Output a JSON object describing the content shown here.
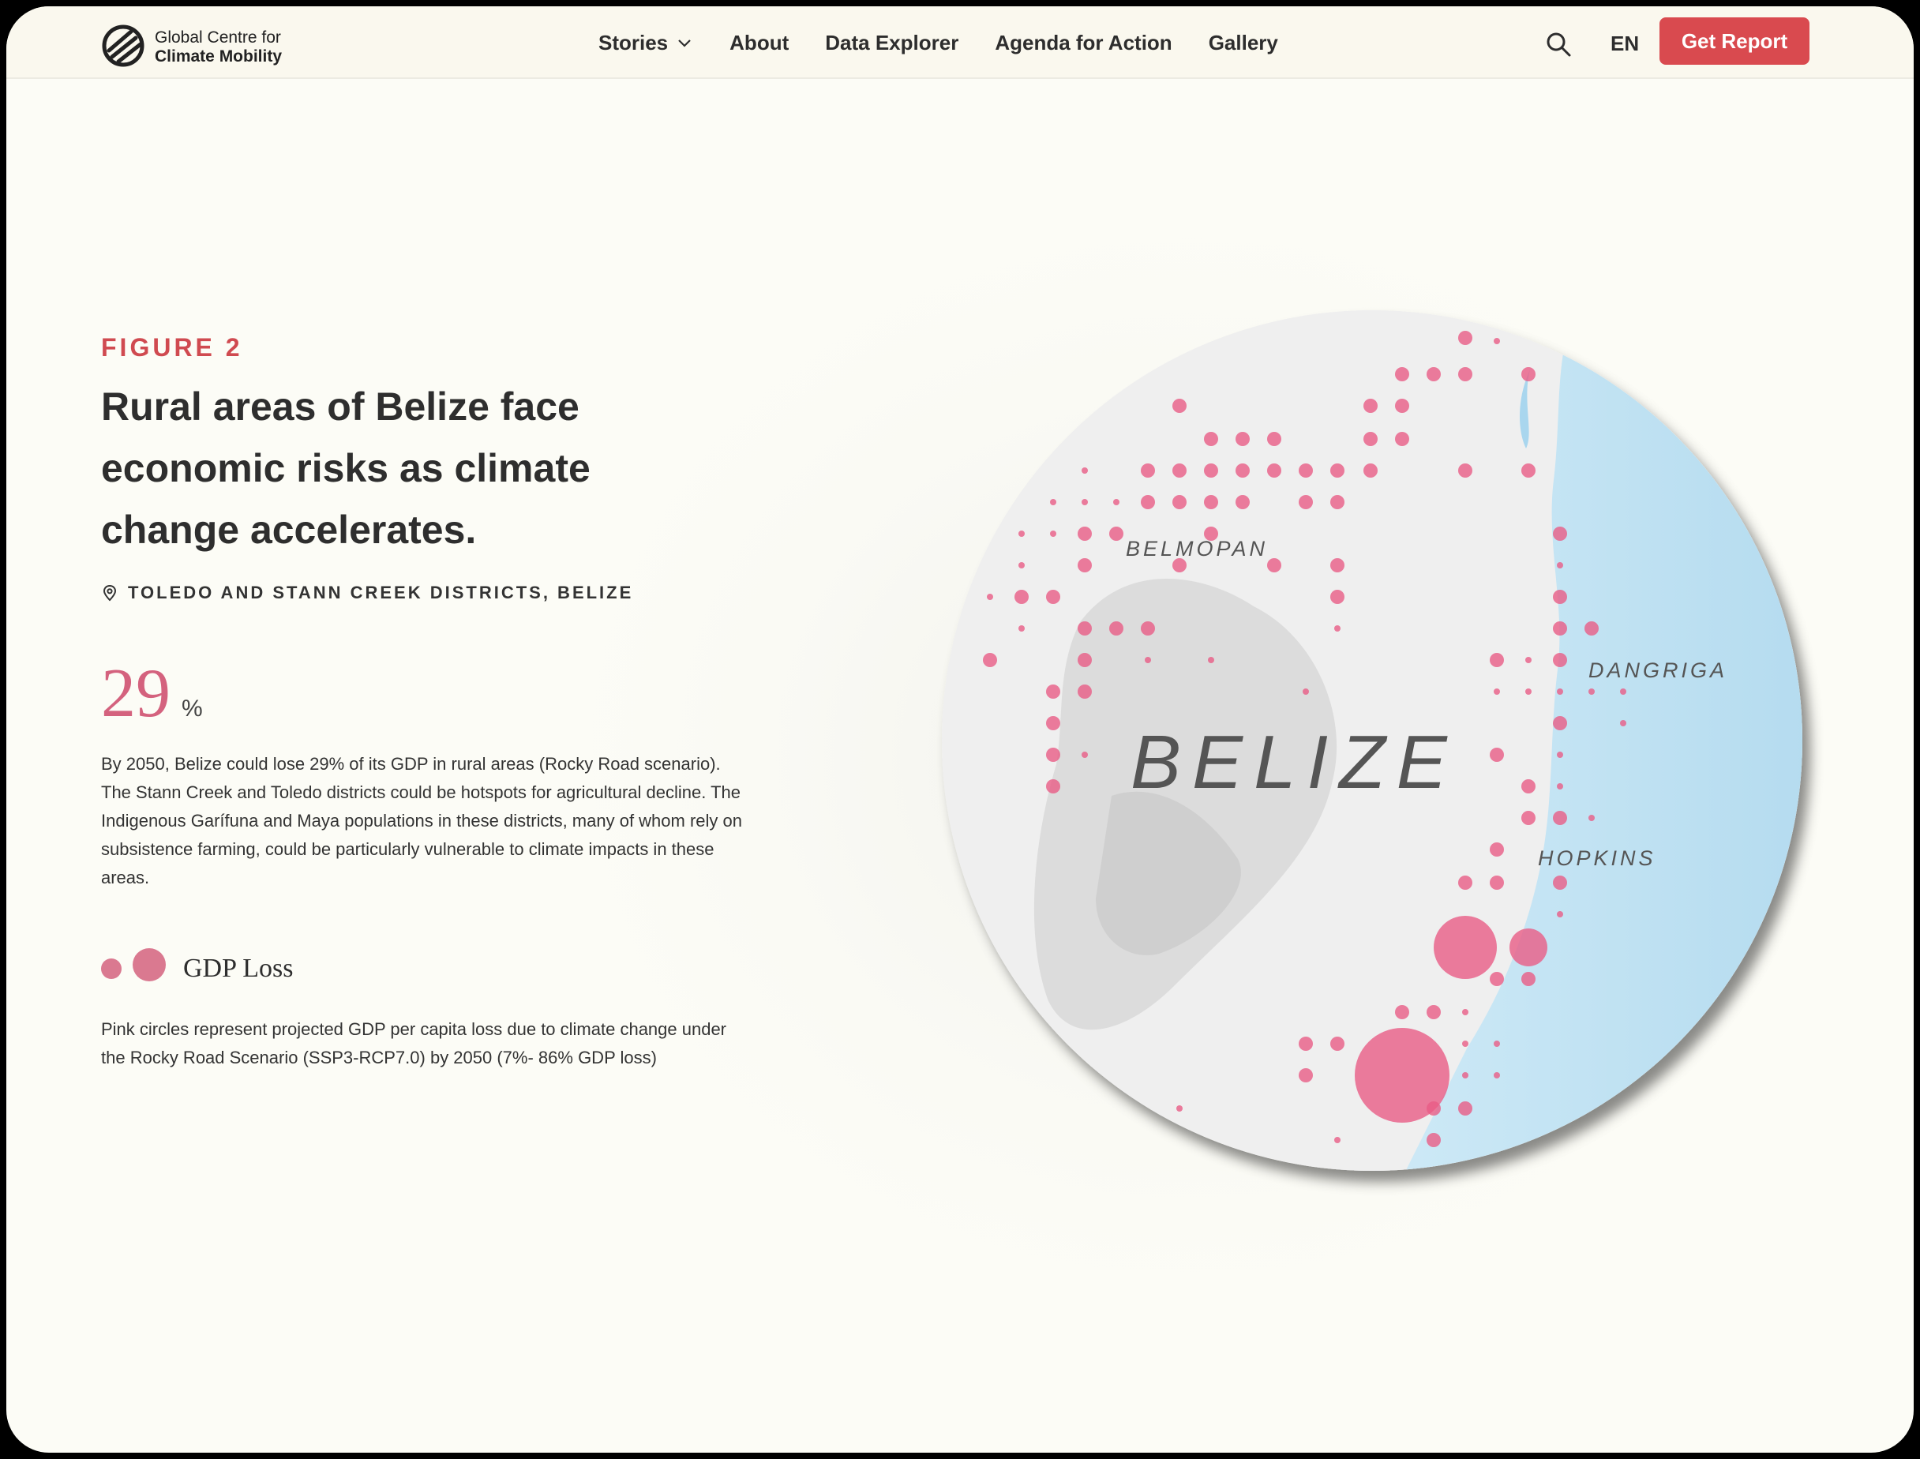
{
  "header": {
    "logo_line1": "Global Centre for",
    "logo_line2": "Climate Mobility",
    "nav": [
      {
        "label": "Stories",
        "dropdown": true
      },
      {
        "label": "About"
      },
      {
        "label": "Data Explorer"
      },
      {
        "label": "Agenda for Action"
      },
      {
        "label": "Gallery"
      }
    ],
    "language": "EN",
    "cta_label": "Get Report"
  },
  "figure": {
    "label": "FIGURE 2",
    "title": "Rural areas of Belize face economic risks as climate change accelerates.",
    "location": "TOLEDO AND STANN CREEK DISTRICTS, BELIZE",
    "stat_value": "29",
    "stat_unit": "%",
    "description": "By 2050, Belize could lose 29% of its GDP in rural areas (Rocky Road scenario). The Stann Creek and Toledo districts could be hotspots for agricultural decline. The Indigenous Garífuna and Maya populations in these districts, many of whom rely on subsistence farming, could be particularly vulnerable to climate impacts in these areas.",
    "legend_title": "GDP Loss",
    "legend_description": "Pink circles represent projected GDP per capita loss due to climate change under the Rocky Road Scenario (SSP3-RCP7.0) by 2050 (7%- 86% GDP loss)"
  },
  "map": {
    "country_label": "BELIZE",
    "place_labels": [
      "BELMOPAN",
      "DANGRIGA",
      "HOPKINS"
    ],
    "colors": {
      "land": "#eeeeee",
      "sea": "#bfe1f2",
      "circle": "#e85c86"
    }
  }
}
